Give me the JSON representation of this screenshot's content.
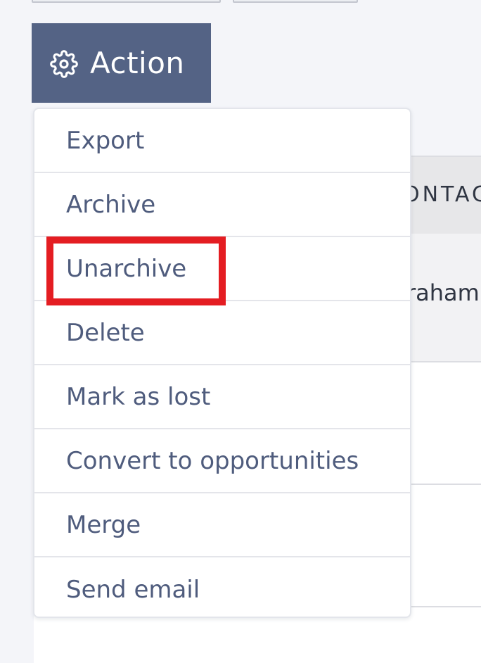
{
  "action_button": {
    "label": "Action",
    "icon": "gear-icon"
  },
  "table": {
    "header_partial": "ONTAC",
    "row1_partial": "raham"
  },
  "menu": {
    "items": [
      {
        "label": "Export"
      },
      {
        "label": "Archive"
      },
      {
        "label": "Unarchive"
      },
      {
        "label": "Delete"
      },
      {
        "label": "Mark as lost"
      },
      {
        "label": "Convert to opportunities"
      },
      {
        "label": "Merge"
      },
      {
        "label": "Send email"
      }
    ]
  },
  "colors": {
    "action_bg": "#546385",
    "menu_text": "#4f5c7d",
    "highlight": "#e41d22"
  }
}
